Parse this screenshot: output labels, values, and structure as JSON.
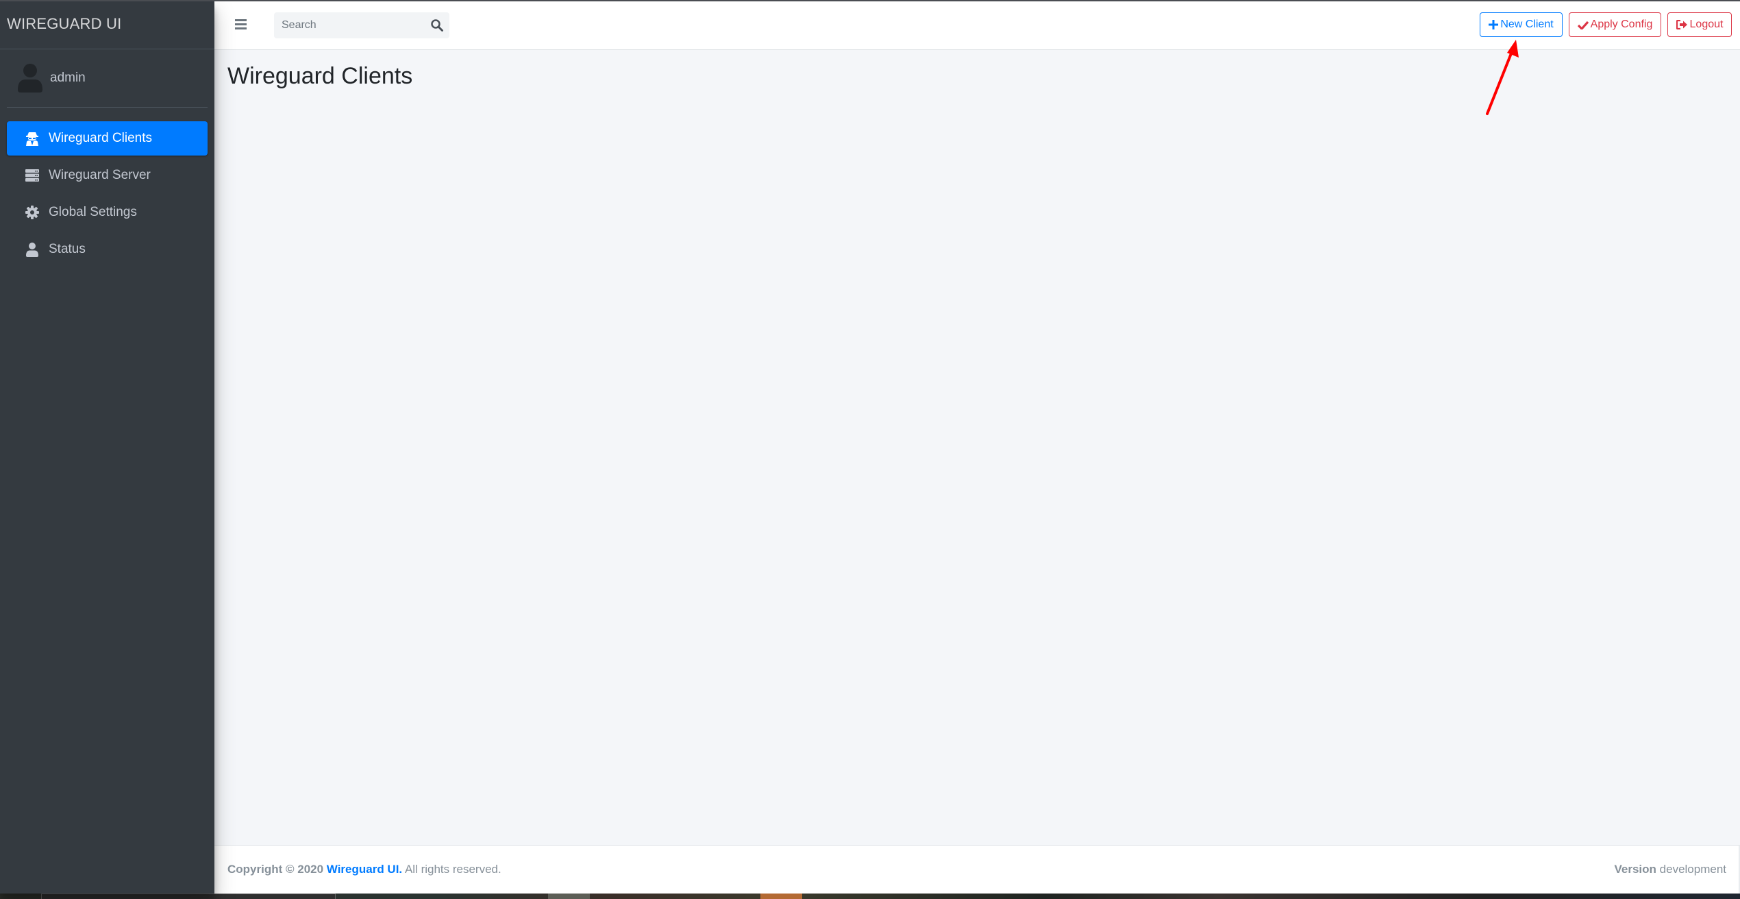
{
  "brand": {
    "title": "WIREGUARD UI"
  },
  "user": {
    "name": "admin",
    "icon": "user-icon"
  },
  "sidebar": {
    "items": [
      {
        "label": "Wireguard Clients",
        "icon": "user-secret-icon",
        "active": true
      },
      {
        "label": "Wireguard Server",
        "icon": "server-icon",
        "active": false
      },
      {
        "label": "Global Settings",
        "icon": "gear-icon",
        "active": false
      },
      {
        "label": "Status",
        "icon": "user-icon",
        "active": false
      }
    ]
  },
  "navbar": {
    "menu_icon": "hamburger-icon",
    "search": {
      "placeholder": "Search",
      "value": "",
      "icon": "search-icon"
    },
    "buttons": {
      "new_client": "New Client",
      "apply_config": "Apply Config",
      "logout": "Logout"
    }
  },
  "content": {
    "title": "Wireguard Clients"
  },
  "footer": {
    "copyright_prefix": "Copyright © 2020",
    "brand_link": "Wireguard UI.",
    "rights": "All rights reserved.",
    "version_label": "Version",
    "version_value": "development"
  },
  "colors": {
    "sidebar_bg": "#343a40",
    "active": "#007bff",
    "danger": "#dc3545",
    "content_bg": "#f4f6f9",
    "annotation_arrow": "#ff0000"
  }
}
